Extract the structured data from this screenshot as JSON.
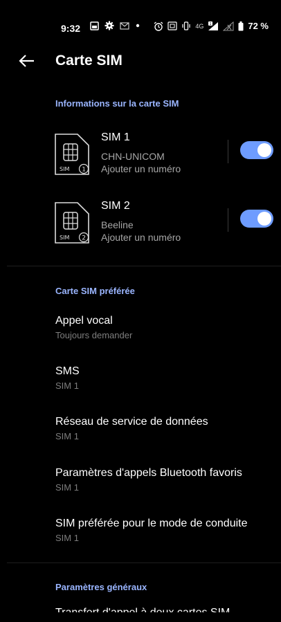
{
  "status_bar": {
    "time": "9:32",
    "battery_percent": "72 %",
    "icons_left": [
      "screenshot-icon",
      "gear-icon",
      "mail-icon",
      "dot-icon"
    ],
    "icons_right": [
      "alarm-icon",
      "nfc-icon",
      "vibrate-icon",
      "4g-icon",
      "signal-sim1-icon",
      "signal-sim2-icon",
      "battery-icon"
    ],
    "network_label": "4G"
  },
  "app_bar": {
    "title": "Carte SIM"
  },
  "sim_info": {
    "section_title": "Informations sur la carte SIM",
    "sims": [
      {
        "name": "SIM 1",
        "carrier": "CHN-UNICOM",
        "number": "Ajouter un numéro",
        "badge": "1",
        "label": "SIM",
        "enabled": true
      },
      {
        "name": "SIM 2",
        "carrier": "Beeline",
        "number": "Ajouter un numéro",
        "badge": "2",
        "label": "SIM",
        "enabled": true
      }
    ]
  },
  "preferred": {
    "section_title": "Carte SIM préférée",
    "items": [
      {
        "title": "Appel vocal",
        "value": "Toujours demander"
      },
      {
        "title": "SMS",
        "value": "SIM 1"
      },
      {
        "title": "Réseau de service de données",
        "value": "SIM 1"
      },
      {
        "title": "Paramètres d'appels Bluetooth favoris",
        "value": "SIM 1"
      },
      {
        "title": "SIM préférée pour le mode de conduite",
        "value": "SIM 1"
      }
    ]
  },
  "general": {
    "section_title": "Paramètres généraux",
    "items": [
      {
        "title": "Transfert d'appel à deux cartes SIM"
      }
    ]
  },
  "colors": {
    "accent": "#9ab5ff",
    "toggle_on": "#6e9cff",
    "secondary_text": "#a7a7a7"
  }
}
